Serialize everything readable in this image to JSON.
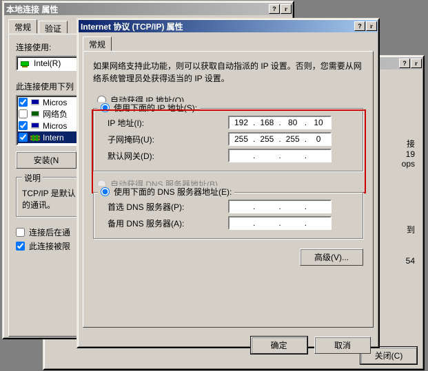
{
  "statusWindow": {
    "close_label": "关闭(C)",
    "help_icon": "?",
    "close_icon": "r",
    "info_row1_left": "接",
    "info_row1_right": "19",
    "info_row2": "ops",
    "info_row3_left": "到",
    "info_row4": "54"
  },
  "lanProps": {
    "title": "本地连接 属性",
    "tabs": {
      "tab0": "常规",
      "tab1": "验证"
    },
    "connect_using": "连接使用:",
    "adapter": "Intel(R)",
    "items_label": "此连接使用下列",
    "items": {
      "0": {
        "label": "Micros"
      },
      "1": {
        "label": "网络负"
      },
      "2": {
        "label": "Micros"
      },
      "3": {
        "label": "Intern"
      }
    },
    "install_btn": "安装(N",
    "desc_title": "说明",
    "desc_body": "TCP/IP 是默认的通讯。",
    "chk_notify": "连接后在通",
    "chk_limited": "此连接被限"
  },
  "tcpip": {
    "title": "Internet 协议 (TCP/IP) 属性",
    "tab": "常规",
    "help_icon": "?",
    "close_icon": "r",
    "intro": "如果网络支持此功能，则可以获取自动指派的 IP 设置。否则，您需要从网络系统管理员处获得适当的 IP 设置。",
    "radio_auto_ip": "自动获得 IP 地址(O)",
    "radio_manual_ip": "使用下面的 IP 地址(S):",
    "ip_label": "IP 地址(I):",
    "mask_label": "子网掩码(U):",
    "gw_label": "默认网关(D):",
    "radio_auto_dns": "自动获得 DNS 服务器地址(B)",
    "radio_manual_dns": "使用下面的 DNS 服务器地址(E):",
    "dns1_label": "首选 DNS 服务器(P):",
    "dns2_label": "备用 DNS 服务器(A):",
    "advanced_btn": "高级(V)...",
    "ok_btn": "确定",
    "cancel_btn": "取消",
    "ip": {
      "o1": "192",
      "o2": "168",
      "o3": "80",
      "o4": "10"
    },
    "mask": {
      "o1": "255",
      "o2": "255",
      "o3": "255",
      "o4": "0"
    },
    "gw": {
      "o1": "",
      "o2": "",
      "o3": "",
      "o4": ""
    },
    "dns1": {
      "o1": "",
      "o2": "",
      "o3": "",
      "o4": ""
    },
    "dns2": {
      "o1": "",
      "o2": "",
      "o3": "",
      "o4": ""
    }
  }
}
